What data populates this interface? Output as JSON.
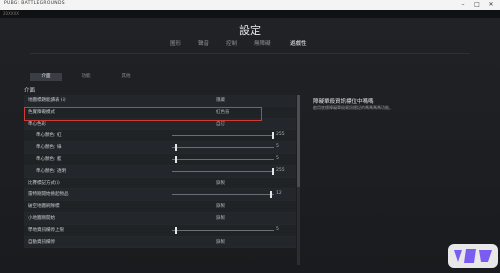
{
  "window": {
    "title": "PUBG: BATTLEGROUNDS",
    "subtitle": "20XXXX"
  },
  "page": {
    "title": "設定"
  },
  "top_tabs": [
    {
      "label": "圖形",
      "active": false
    },
    {
      "label": "聲音",
      "active": false
    },
    {
      "label": "控制",
      "active": false
    },
    {
      "label": "無障礙",
      "active": false
    },
    {
      "label": "遊戲性",
      "active": true
    }
  ],
  "sub_tabs": [
    {
      "label": "介面",
      "active": true
    },
    {
      "label": "功能",
      "active": false
    },
    {
      "label": "其他",
      "active": false
    }
  ],
  "section": {
    "title": "介面"
  },
  "rows": [
    {
      "label": "地圖標題能讀表 (i)",
      "indent": false,
      "value": "隱藏",
      "slider": null,
      "number": ""
    },
    {
      "label": "色覺障礙模式",
      "indent": false,
      "value": "紅色盲",
      "slider": null,
      "number": ""
    },
    {
      "label": "準心色彩",
      "indent": false,
      "value": "自訂",
      "slider": null,
      "number": ""
    },
    {
      "label": "準心顏色: 紅",
      "indent": true,
      "value": "",
      "slider": 1.0,
      "number": "255"
    },
    {
      "label": "準心顏色: 綠",
      "indent": true,
      "value": "",
      "slider": 0.03,
      "number": "5"
    },
    {
      "label": "準心顏色: 藍",
      "indent": true,
      "value": "",
      "slider": 0.03,
      "number": "5"
    },
    {
      "label": "準心顏色: 透明",
      "indent": true,
      "value": "",
      "slider": 1.0,
      "number": "255"
    },
    {
      "label": "比賽標記方式(i)",
      "indent": false,
      "value": "錄製",
      "slider": null,
      "number": ""
    },
    {
      "label": "雷特剛開始撿起物品",
      "indent": false,
      "value": "",
      "slider": 0.98,
      "number": "12"
    },
    {
      "label": "破空地圖刷隊標",
      "indent": false,
      "value": "錄製",
      "slider": null,
      "number": ""
    },
    {
      "label": "小地圖剛開始",
      "indent": false,
      "value": "錄製",
      "slider": null,
      "number": ""
    },
    {
      "label": "學地資訊欄停上限",
      "indent": false,
      "value": "",
      "slider": 0.03,
      "number": "5"
    },
    {
      "label": "自動資訊欄停",
      "indent": false,
      "value": "錄製",
      "slider": null,
      "number": ""
    }
  ],
  "detail": {
    "title": "障礙單殺資訊標位中嗎嗎",
    "description": "啟用底標障礙單殺資訊標記的嗎嗎嗎嗎功能。"
  },
  "colors": {
    "highlight": "#d23a34",
    "accent": "#e4e6e8",
    "background": "#1a1c1f"
  }
}
